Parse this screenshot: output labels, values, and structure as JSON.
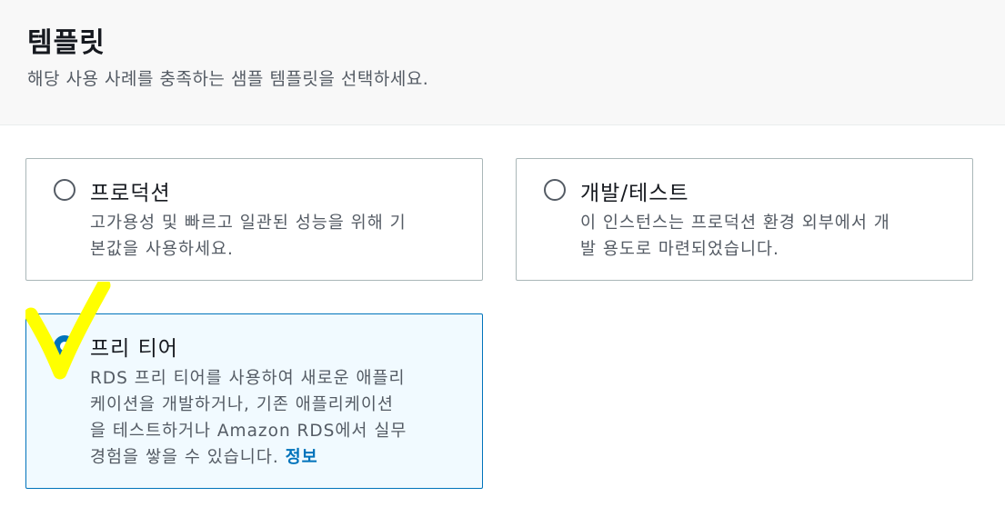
{
  "header": {
    "title": "템플릿",
    "subtitle": "해당 사용 사례를 충족하는 샘플 템플릿을 선택하세요."
  },
  "templates": [
    {
      "title": "프로덕션",
      "description_lines": [
        "고가용성 및 빠르고 일관된 성능을 위해 기",
        "본값을 사용하세요."
      ],
      "selected": false
    },
    {
      "title": "개발/테스트",
      "description_lines": [
        "이 인스턴스는 프로덕션 환경 외부에서 개",
        "발 용도로 마련되었습니다."
      ],
      "selected": false
    },
    {
      "title": "프리 티어",
      "description_lines": [
        "RDS 프리 티어를 사용하여 새로운 애플리",
        "케이션을 개발하거나, 기존 애플리케이션",
        "을 테스트하거나 Amazon RDS에서 실무",
        "경험을 쌓을 수 있습니다. "
      ],
      "info_link": "정보",
      "selected": true
    }
  ],
  "colors": {
    "accent": "#0073bb",
    "selected_bg": "#f1faff",
    "highlight_mark": "#ffff00"
  }
}
